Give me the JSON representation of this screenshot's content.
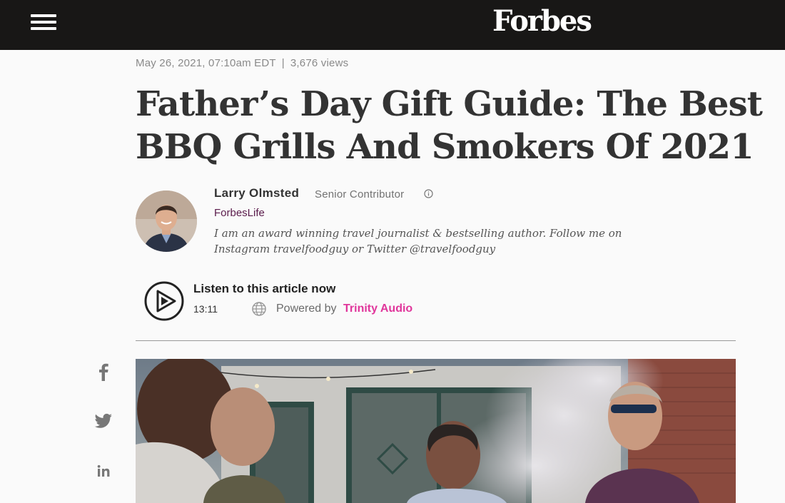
{
  "header": {
    "logo": "Forbes",
    "menu_icon": "hamburger-menu-icon"
  },
  "meta": {
    "date": "May 26, 2021, 07:10am EDT",
    "separator": "|",
    "views": "3,676 views"
  },
  "article": {
    "title": "Father’s Day Gift Guide: The Best BBQ Grills And Smokers Of 2021"
  },
  "author": {
    "name": "Larry Olmsted",
    "role": "Senior Contributor",
    "info_icon": "info-circle-icon",
    "channel": "ForbesLife",
    "bio": "I am an award winning travel journalist & bestselling author. Follow me on Instagram travelfoodguy or Twitter @travelfoodguy"
  },
  "audio": {
    "play_icon": "play-circle-icon",
    "title": "Listen to this article now",
    "duration": "13:11",
    "globe_icon": "globe-icon",
    "powered_by": "Powered by",
    "provider": "Trinity Audio"
  },
  "share": {
    "items": [
      {
        "icon": "facebook-icon"
      },
      {
        "icon": "twitter-icon"
      },
      {
        "icon": "linkedin-icon"
      }
    ]
  },
  "colors": {
    "header_bg": "#181716",
    "channel": "#5a1b4b",
    "provider": "#e0369b"
  }
}
